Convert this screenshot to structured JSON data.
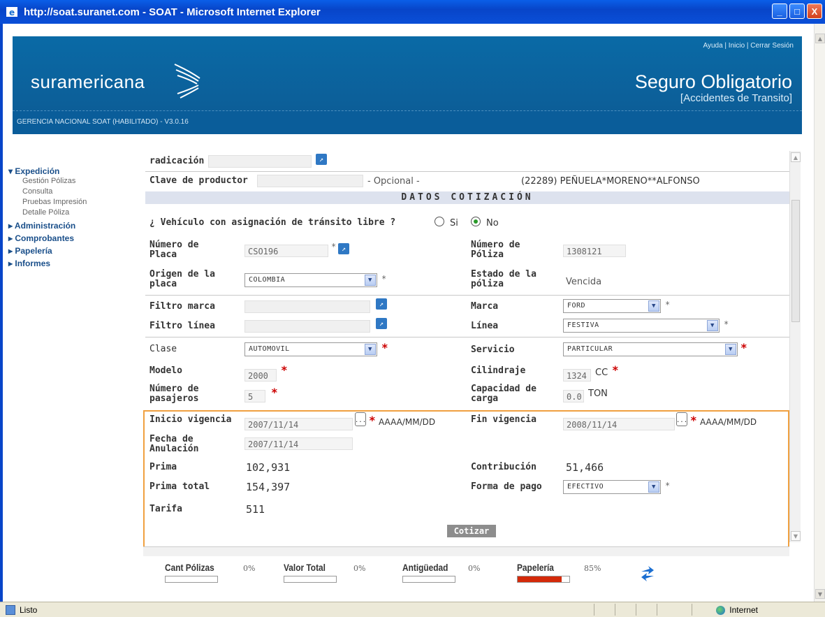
{
  "window": {
    "title": "http://soat.suranet.com - SOAT - Microsoft Internet Explorer",
    "minimize": "_",
    "maximize": "□",
    "close": "X"
  },
  "header": {
    "top_links": "Ayuda  |  Inicio  |  Cerrar Sesión",
    "logo": "suramericana",
    "title": "Seguro Obligatorio",
    "subtitle": "[Accidentes de Transito]",
    "subbar": "GERENCIA NACIONAL SOAT (HABILITADO) - V3.0.16"
  },
  "nav": {
    "expedicion": "▾ Expedición",
    "expedicion_items": [
      "Gestión Pólizas",
      "Consulta",
      "Pruebas Impresión",
      "Detalle Póliza"
    ],
    "administracion": "▸ Administración",
    "comprobantes": "▸ Comprobantes",
    "papeleria": "▸ Papelería",
    "informes": "▸ Informes"
  },
  "form": {
    "radicacion_label": "radicación",
    "clave_label": "Clave de productor",
    "opcional": "- Opcional -",
    "productor": "(22289) PEÑUELA*MORENO**ALFONSO",
    "section_title": "DATOS COTIZACIÓN",
    "transito_question": "¿ Vehículo con asignación de tránsito libre ?",
    "si": "Si",
    "no": "No",
    "numero_placa_label": "Número de Placa",
    "numero_placa_value": "CSO196",
    "numero_poliza_label": "Número de Póliza",
    "numero_poliza_value": "1308121",
    "origen_label": "Origen de la placa",
    "origen_value": "COLOMBIA",
    "estado_label": "Estado de la póliza",
    "estado_value": "Vencida",
    "filtro_marca_label": "Filtro marca",
    "marca_label": "Marca",
    "marca_value": "FORD",
    "filtro_linea_label": "Filtro línea",
    "linea_label": "Línea",
    "linea_value": "FESTIVA",
    "clase_label": "Clase",
    "clase_value": "AUTOMOVIL",
    "servicio_label": "Servicio",
    "servicio_value": "PARTICULAR",
    "modelo_label": "Modelo",
    "modelo_value": "2000",
    "cilindraje_label": "Cilindraje",
    "cilindraje_value": "1324",
    "cilindraje_unit": "CC",
    "pasajeros_label": "Número de pasajeros",
    "pasajeros_value": "5",
    "capacidad_label": "Capacidad de carga",
    "capacidad_value": "0.0",
    "capacidad_unit": "TON",
    "inicio_label": "Inicio vigencia",
    "inicio_value": "2007/11/14",
    "date_format": "AAAA/MM/DD",
    "fin_label": "Fin vigencia",
    "fin_value": "2008/11/14",
    "anulacion_label": "Fecha de Anulación",
    "anulacion_value": "2007/11/14",
    "prima_label": "Prima",
    "prima_value": "102,931",
    "contribucion_label": "Contribución",
    "contribucion_value": "51,466",
    "prima_total_label": "Prima total",
    "prima_total_value": "154,397",
    "forma_pago_label": "Forma de pago",
    "forma_pago_value": "EFECTIVO",
    "tarifa_label": "Tarifa",
    "tarifa_value": "511",
    "cotizar": "Cotizar",
    "cal_btn": "...",
    "star": "*"
  },
  "indicators": [
    {
      "label": "Cant Pólizas",
      "percent_text": "0%",
      "fill": 0
    },
    {
      "label": "Valor Total",
      "percent_text": "0%",
      "fill": 0
    },
    {
      "label": "Antigüedad",
      "percent_text": "0%",
      "fill": 0
    },
    {
      "label": "Papelería",
      "percent_text": "85%",
      "fill": 0.85
    }
  ],
  "status": {
    "left": "Listo",
    "right": "Internet"
  },
  "colors": {
    "banner": "#0a6aa6",
    "required": "#cc0000",
    "highlight": "#f0a040",
    "papeleria_fill": "#d42a0a"
  }
}
